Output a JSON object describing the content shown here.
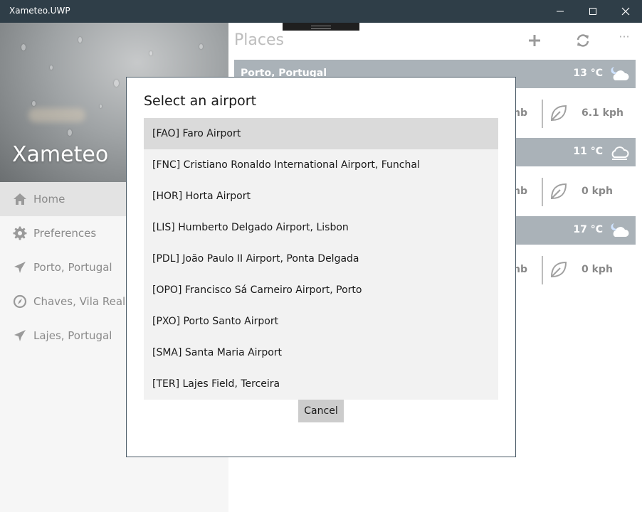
{
  "window": {
    "title": "Xameteo.UWP",
    "minimize_label": "—",
    "maximize_label": "☐",
    "close_label": "✕"
  },
  "sidebar": {
    "brand": "Xameteo",
    "items": [
      {
        "label": "Home",
        "icon": "home-icon",
        "active": true
      },
      {
        "label": "Preferences",
        "icon": "gear-icon",
        "active": false
      },
      {
        "label": "Porto, Portugal",
        "icon": "airplane-icon",
        "active": false
      },
      {
        "label": "Chaves, Vila Real",
        "icon": "compass-icon",
        "active": false
      },
      {
        "label": "Lajes, Portugal",
        "icon": "airplane-icon",
        "active": false
      }
    ]
  },
  "main": {
    "title": "Places",
    "toolbar": {
      "add_icon": "plus-icon",
      "refresh_icon": "refresh-icon",
      "more_label": "···"
    },
    "cards": [
      {
        "name": "Porto, Portugal",
        "temp": "13 °C",
        "weather_icon": "partly-cloudy-night-icon",
        "pressure_partial": "nb",
        "wind": "6.1 kph"
      },
      {
        "name": "",
        "temp": "11 °C",
        "weather_icon": "cloud-icon",
        "pressure_partial": "nb",
        "wind": "0 kph"
      },
      {
        "name": "",
        "temp": "17 °C",
        "weather_icon": "partly-cloudy-night-icon",
        "pressure_partial": "nb",
        "wind": "0 kph"
      }
    ]
  },
  "dialog": {
    "title": "Select an airport",
    "airports": [
      "[FAO] Faro Airport",
      "[FNC] Cristiano Ronaldo International Airport, Funchal",
      "[HOR] Horta Airport",
      "[LIS] Humberto Delgado Airport, Lisbon",
      "[PDL] João Paulo II Airport, Ponta Delgada",
      "[OPO] Francisco Sá Carneiro Airport, Porto",
      "[PXO] Porto Santo Airport",
      "[SMA] Santa Maria Airport",
      "[TER] Lajes Field, Terceira"
    ],
    "selected_index": 0,
    "cancel_label": "Cancel"
  },
  "colors": {
    "titlebar": "#2f3e48",
    "card_header": "#aab2b8",
    "accent_text": "#8a8a8a"
  }
}
